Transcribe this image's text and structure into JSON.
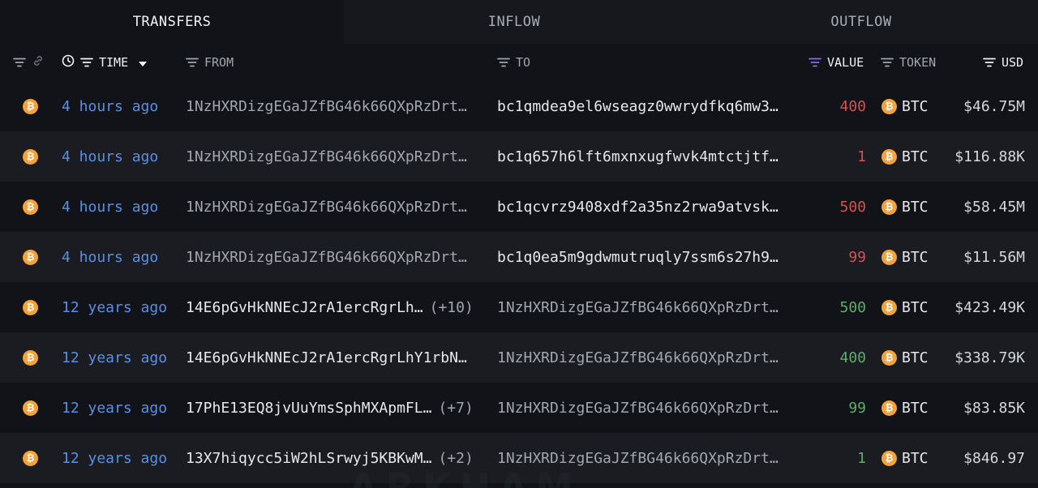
{
  "tabs": [
    {
      "label": "TRANSFERS",
      "active": true
    },
    {
      "label": "INFLOW",
      "active": false
    },
    {
      "label": "OUTFLOW",
      "active": false
    }
  ],
  "columns": {
    "time": "TIME",
    "from": "FROM",
    "to": "TO",
    "value": "VALUE",
    "token": "TOKEN",
    "usd": "USD"
  },
  "colors": {
    "time_link": "#5a8fe3",
    "value_out": "#d5524f",
    "value_in": "#5cae6a",
    "bitcoin": "#f3a33a",
    "value_filter_active": "#8a6fd6"
  },
  "icons": {
    "coin": "bitcoin-icon",
    "coin_glyph": "₿"
  },
  "rows": [
    {
      "time": "4 hours ago",
      "from": "1NzHXRDizgEGaJZfBG46k66QXpRzDrt…",
      "from_extra": "",
      "to": "bc1qmdea9el6wseagz0wwrydfkq6mw3…",
      "value": "400",
      "direction": "out",
      "token": "BTC",
      "usd": "$46.75M"
    },
    {
      "time": "4 hours ago",
      "from": "1NzHXRDizgEGaJZfBG46k66QXpRzDrt…",
      "from_extra": "",
      "to": "bc1q657h6lft6mxnxugfwvk4mtctjtf…",
      "value": "1",
      "direction": "out",
      "token": "BTC",
      "usd": "$116.88K"
    },
    {
      "time": "4 hours ago",
      "from": "1NzHXRDizgEGaJZfBG46k66QXpRzDrt…",
      "from_extra": "",
      "to": "bc1qcvrz9408xdf2a35nz2rwa9atvsk…",
      "value": "500",
      "direction": "out",
      "token": "BTC",
      "usd": "$58.45M"
    },
    {
      "time": "4 hours ago",
      "from": "1NzHXRDizgEGaJZfBG46k66QXpRzDrt…",
      "from_extra": "",
      "to": "bc1q0ea5m9gdwmutruqly7ssm6s27h9…",
      "value": "99",
      "direction": "out",
      "token": "BTC",
      "usd": "$11.56M"
    },
    {
      "time": "12 years ago",
      "from": "14E6pGvHkNNEcJ2rA1ercRgrLh…",
      "from_extra": "(+10)",
      "to": "1NzHXRDizgEGaJZfBG46k66QXpRzDrt…",
      "value": "500",
      "direction": "in",
      "token": "BTC",
      "usd": "$423.49K"
    },
    {
      "time": "12 years ago",
      "from": "14E6pGvHkNNEcJ2rA1ercRgrLhY1rbN…",
      "from_extra": "",
      "to": "1NzHXRDizgEGaJZfBG46k66QXpRzDrt…",
      "value": "400",
      "direction": "in",
      "token": "BTC",
      "usd": "$338.79K"
    },
    {
      "time": "12 years ago",
      "from": "17PhE13EQ8jvUuYmsSphMXApmFL…",
      "from_extra": "(+7)",
      "to": "1NzHXRDizgEGaJZfBG46k66QXpRzDrt…",
      "value": "99",
      "direction": "in",
      "token": "BTC",
      "usd": "$83.85K"
    },
    {
      "time": "12 years ago",
      "from": "13X7hiqycc5iW2hLSrwyj5KBKwM…",
      "from_extra": "(+2)",
      "to": "1NzHXRDizgEGaJZfBG46k66QXpRzDrt…",
      "value": "1",
      "direction": "in",
      "token": "BTC",
      "usd": "$846.97"
    }
  ],
  "watermark": "ARKHAM"
}
